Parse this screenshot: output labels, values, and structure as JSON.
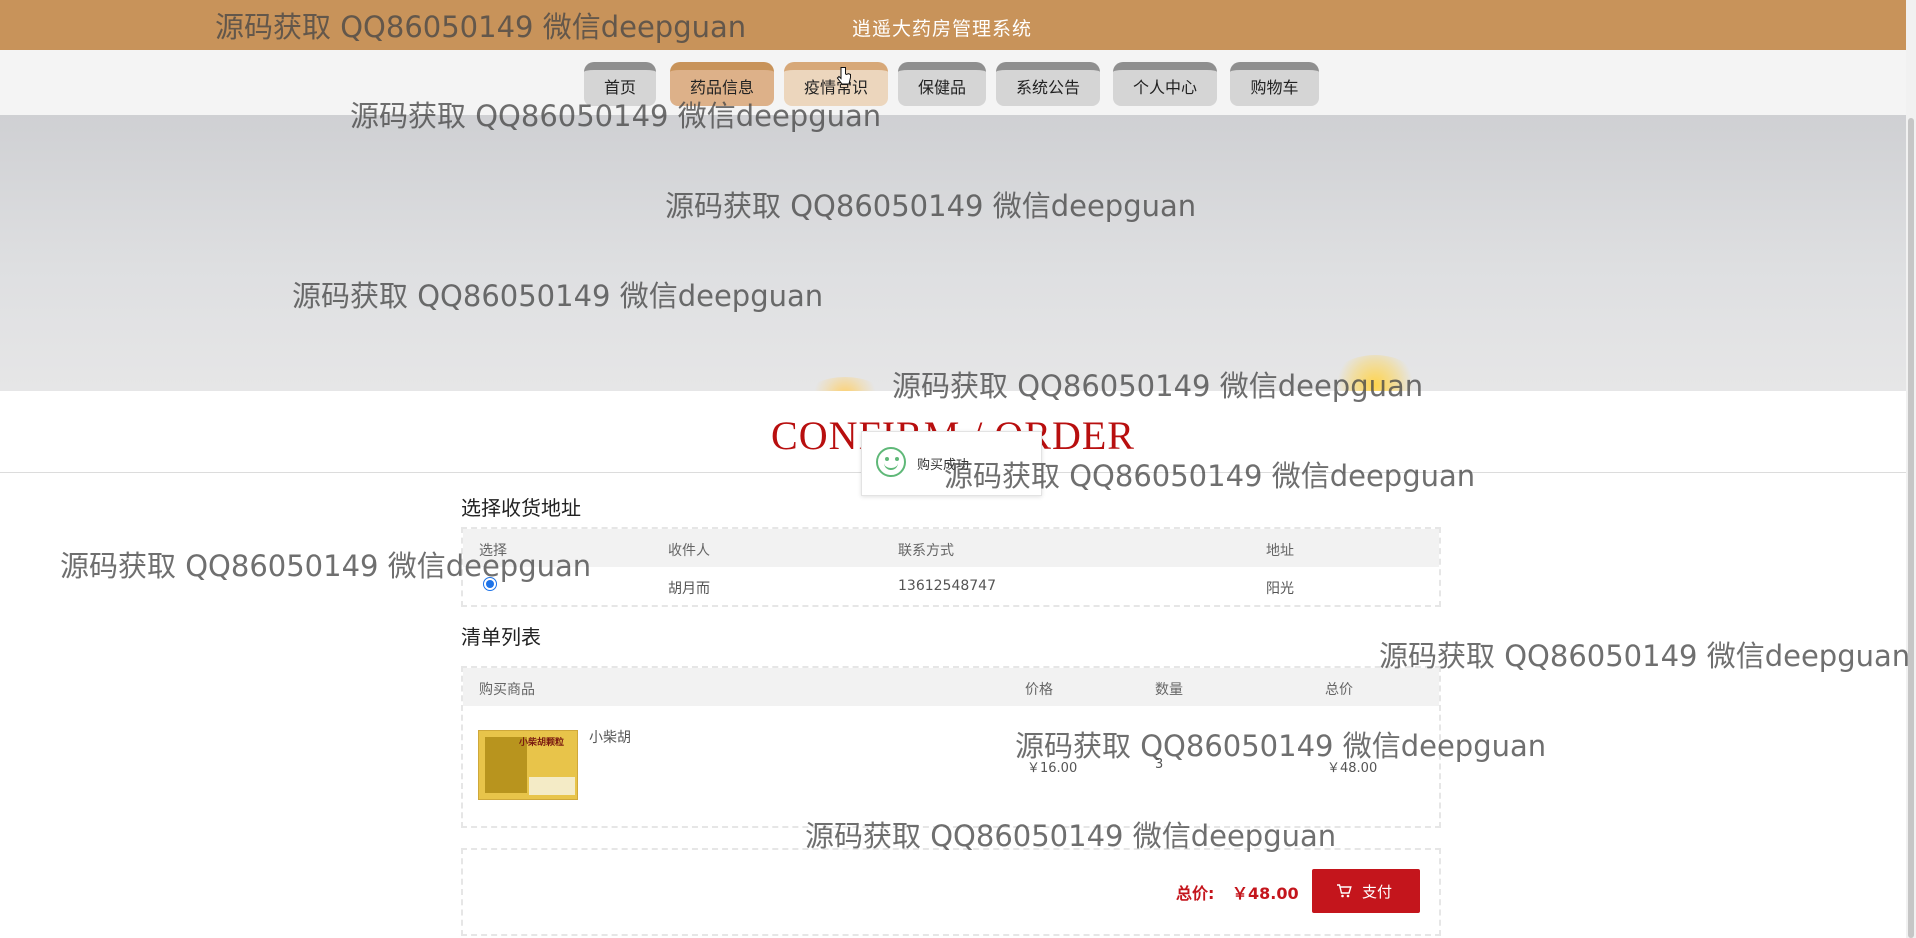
{
  "header": {
    "site_title": "逍遥大药房管理系统"
  },
  "nav": [
    {
      "label": "首页",
      "state": "normal"
    },
    {
      "label": "药品信息",
      "state": "active"
    },
    {
      "label": "疫情常识",
      "state": "hover"
    },
    {
      "label": "保健品",
      "state": "normal"
    },
    {
      "label": "系统公告",
      "state": "normal"
    },
    {
      "label": "个人中心",
      "state": "normal"
    },
    {
      "label": "购物车",
      "state": "normal"
    }
  ],
  "page": {
    "heading": "CONFIRM / ORDER"
  },
  "toast": {
    "message": "购买成功",
    "icon": "smile-icon",
    "color": "#5fb878"
  },
  "address_section": {
    "title": "选择收货地址",
    "columns": [
      "选择",
      "收件人",
      "联系方式",
      "地址"
    ],
    "rows": [
      {
        "selected": true,
        "recipient": "胡月而",
        "phone": "13612548747",
        "address": "阳光"
      }
    ]
  },
  "order_section": {
    "title": "清单列表",
    "columns": [
      "购买商品",
      "价格",
      "数量",
      "总价"
    ],
    "items": [
      {
        "name": "小柴胡",
        "image_label": "小柴胡颗粒",
        "price": "￥16.00",
        "quantity": "3",
        "subtotal": "￥48.00"
      }
    ]
  },
  "summary": {
    "total_label": "总价:",
    "total_value": "￥48.00",
    "pay_label": "支付",
    "pay_icon": "cart-icon"
  },
  "watermark": {
    "text": "源码获取 QQ86050149 微信deepguan"
  },
  "colors": {
    "topbar": "#c8935a",
    "accent_red": "#c4151c",
    "heading_red": "#b80f0f",
    "active_tab": "#ddb189"
  }
}
